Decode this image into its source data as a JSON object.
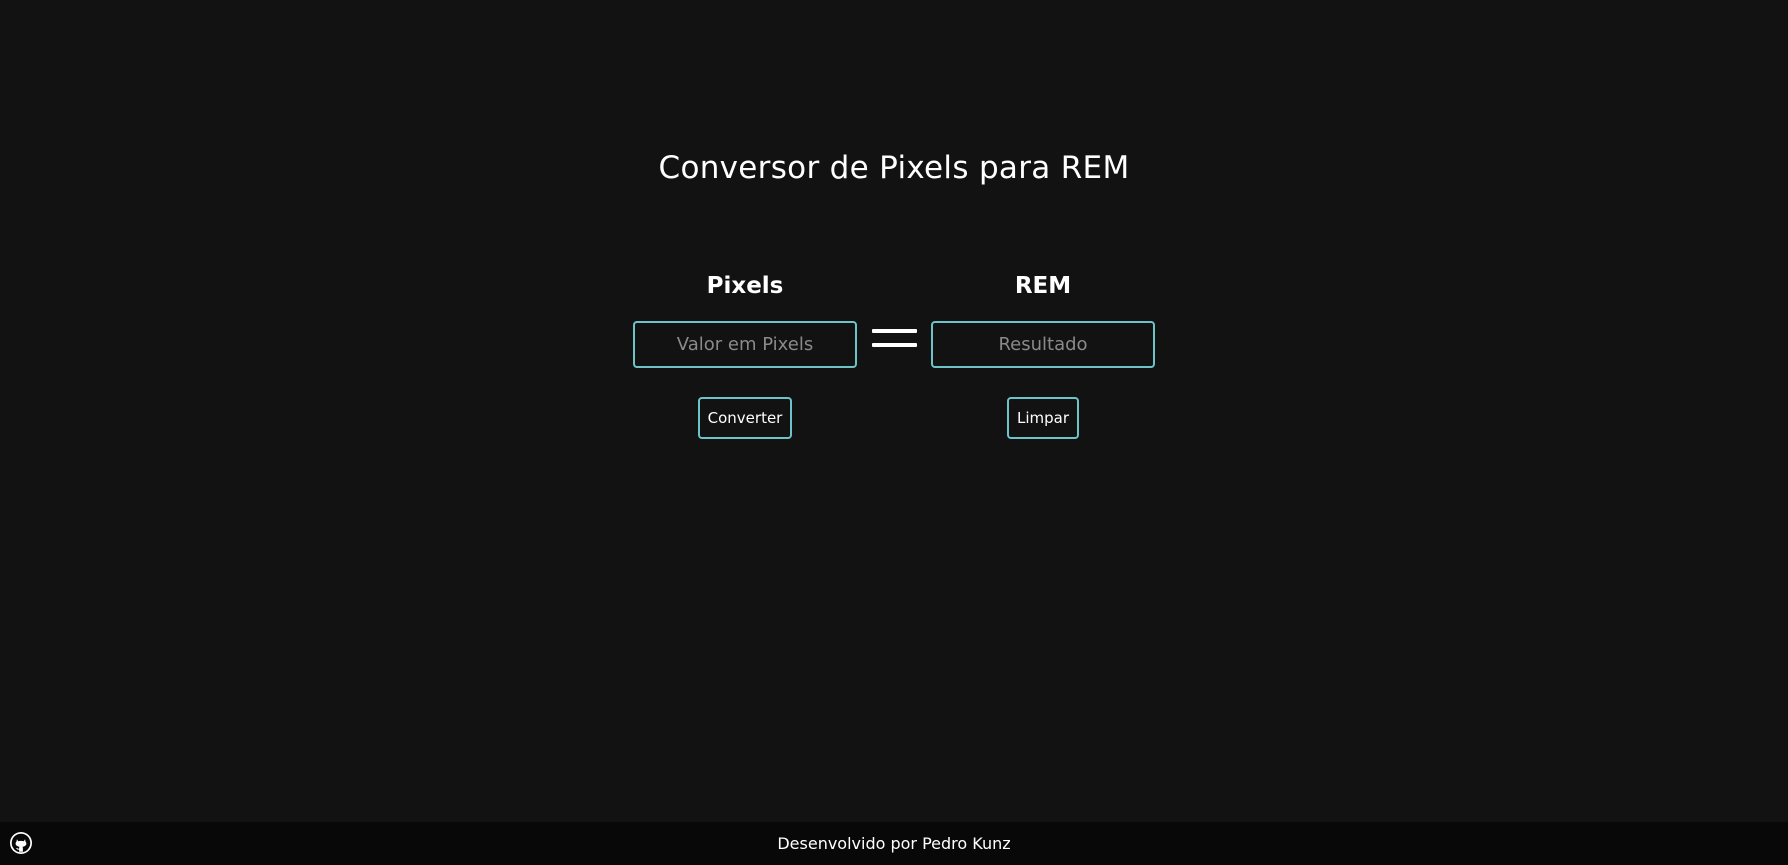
{
  "header": {
    "title": "Conversor de Pixels para REM"
  },
  "converter": {
    "pixels": {
      "label": "Pixels",
      "input_value": "",
      "input_placeholder": "Valor em Pixels",
      "button_label": "Converter"
    },
    "equals_icon": "equals-icon",
    "rem": {
      "label": "REM",
      "output_value": "",
      "output_placeholder": "Resultado",
      "button_label": "Limpar"
    }
  },
  "footer": {
    "text": "Desenvolvido por Pedro Kunz",
    "icon": "github-icon"
  },
  "colors": {
    "background": "#121212",
    "footer_background": "#080808",
    "accent_border": "#6cc4c8",
    "text": "#ffffff",
    "placeholder": "#8a8a8a"
  }
}
